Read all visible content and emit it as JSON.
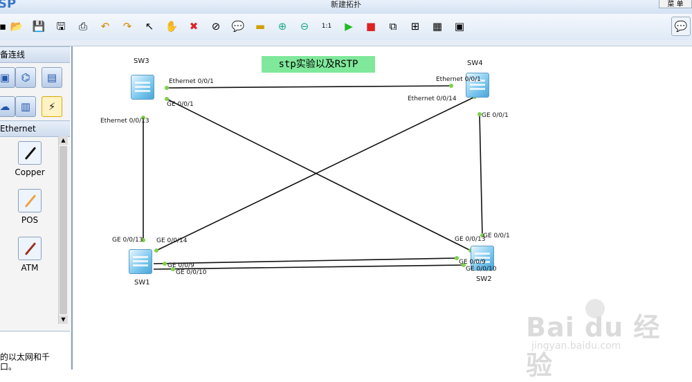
{
  "window": {
    "app_logo": "SP",
    "title": "新建拓扑",
    "menu_right": "菜 单"
  },
  "toolbar": {
    "buttons": [
      "new-topology",
      "open",
      "save",
      "save-as",
      "print",
      "undo",
      "redo",
      "select",
      "pan",
      "delete",
      "remove-all-links",
      "text",
      "palette",
      "zoom-in",
      "zoom-out",
      "fit",
      "start-devices",
      "stop-devices",
      "capture",
      "topology",
      "grid",
      "terminal"
    ]
  },
  "left_panel": {
    "devices_header": "备连线",
    "connections_header": "Ethernet",
    "connections": [
      {
        "label": "Copper",
        "color": "#111111"
      },
      {
        "label": "POS",
        "color": "#f0a040"
      },
      {
        "label": "ATM",
        "color": "#a03020"
      }
    ],
    "description_line1": "的以太网和千",
    "description_line2": "口。"
  },
  "topology": {
    "title": "stp实验以及RSTP",
    "devices": {
      "sw1": "SW1",
      "sw2": "SW2",
      "sw3": "SW3",
      "sw4": "SW4"
    },
    "ports": {
      "sw3_e001": "Ethernet 0/0/1",
      "sw3_ge001": "GE 0/0/1",
      "sw3_e0013": "Ethernet 0/0/13",
      "sw4_e001": "Ethernet 0/0/1",
      "sw4_e0014": "Ethernet 0/0/14",
      "sw4_ge001": "GE 0/0/1",
      "sw1_ge0013": "GE 0/0/13",
      "sw1_ge0014": "GE 0/0/14",
      "sw1_ge009": "GE 0/0/9",
      "sw1_ge0010": "GE 0/0/10",
      "sw2_ge001": "GE 0/0/1",
      "sw2_ge0013": "GE 0/0/13",
      "sw2_ge009": "GE 0/0/9",
      "sw2_ge0010": "GE 0/0/10"
    }
  },
  "watermark": {
    "main": "Bai du 经验",
    "sub": "jingyan.baidu.com"
  }
}
